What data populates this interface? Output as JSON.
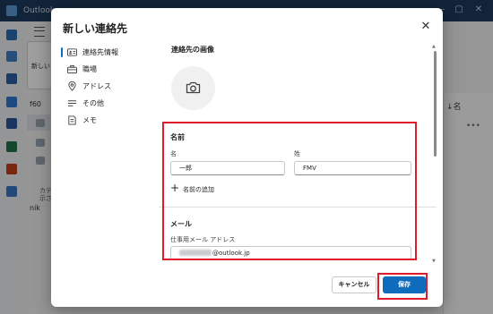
{
  "app": {
    "title": "Outlook"
  },
  "background": {
    "new_card_label": "新しい",
    "folder_label": "f60",
    "folder2_label": "nik",
    "category_label": "カテ\n示さ",
    "sort_label": "名"
  },
  "dialog": {
    "title": "新しい連絡先",
    "close_label": "✕"
  },
  "nav": {
    "items": [
      {
        "label": "連絡先情報",
        "icon": "contact-card-icon",
        "selected": true
      },
      {
        "label": "職場",
        "icon": "briefcase-icon",
        "selected": false
      },
      {
        "label": "アドレス",
        "icon": "location-pin-icon",
        "selected": false
      },
      {
        "label": "その他",
        "icon": "text-lines-icon",
        "selected": false
      },
      {
        "label": "メモ",
        "icon": "note-icon",
        "selected": false
      }
    ]
  },
  "photo": {
    "heading": "連絡先の画像",
    "icon": "camera-icon"
  },
  "name_section": {
    "heading": "名前",
    "first_name_label": "名",
    "first_name_value": "一郎",
    "last_name_label": "姓",
    "last_name_value": "FMV",
    "add_name_label": "名前の追加"
  },
  "email_section": {
    "heading": "メール",
    "work_email_label": "仕事用メール アドレス",
    "work_email_value": "@outlook.jp"
  },
  "buttons": {
    "cancel": "キャンセル",
    "save": "保存"
  },
  "colors": {
    "accent": "#0f6cbd",
    "highlight": "#e0192b",
    "titlebar": "#1e3a5c"
  }
}
